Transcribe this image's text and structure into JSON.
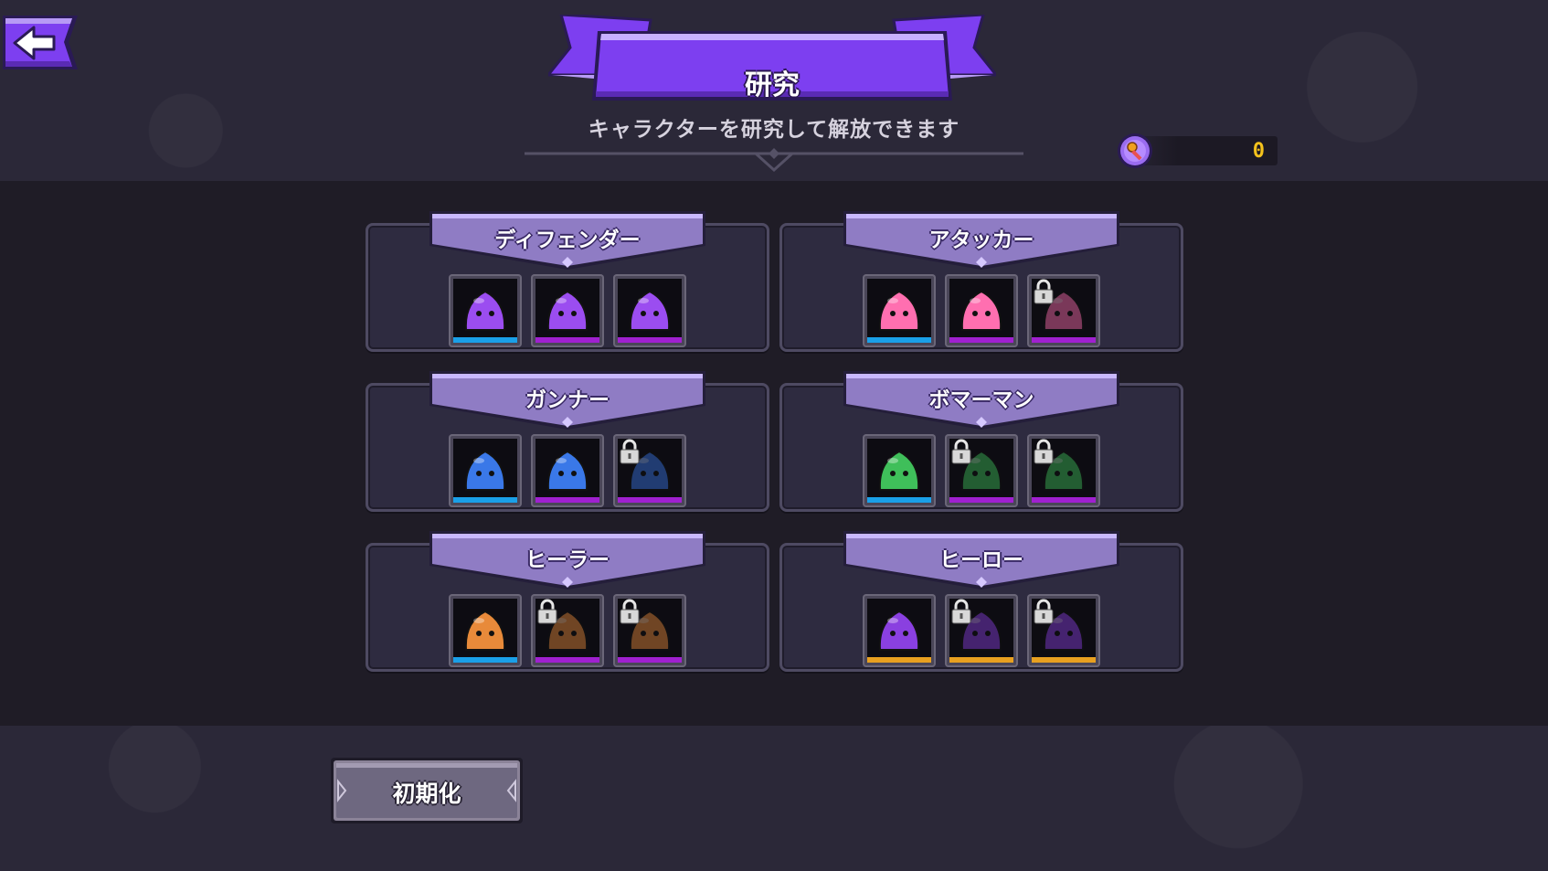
{
  "header": {
    "title": "研究",
    "subtitle": "キャラクターを研究して解放できます",
    "back_icon": "arrow-left-icon"
  },
  "currency": {
    "icon": "research-token-icon",
    "value": "0",
    "color": "#f4c21c"
  },
  "colors": {
    "accent": "#7d3ff0",
    "banner": "#8f7cc4",
    "tier_blue": "#1aa0e8",
    "tier_purple": "#a020d0",
    "tier_gold": "#e8a020"
  },
  "categories": [
    {
      "name": "ディフェンダー",
      "slots": [
        {
          "icon": "purple-slime-defender-icon",
          "tier": "blue",
          "locked": false
        },
        {
          "icon": "purple-slime-knight-icon",
          "tier": "purple",
          "locked": false
        },
        {
          "icon": "purple-slime-shield-icon",
          "tier": "purple",
          "locked": false
        }
      ]
    },
    {
      "name": "アタッカー",
      "slots": [
        {
          "icon": "pink-slime-mace-icon",
          "tier": "blue",
          "locked": false
        },
        {
          "icon": "pink-slime-swordsman-icon",
          "tier": "purple",
          "locked": false
        },
        {
          "icon": "pink-slime-locked-icon",
          "tier": "purple",
          "locked": true
        }
      ]
    },
    {
      "name": "ガンナー",
      "slots": [
        {
          "icon": "blue-slime-gunner-icon",
          "tier": "blue",
          "locked": false
        },
        {
          "icon": "blue-slime-rifleman-icon",
          "tier": "purple",
          "locked": false
        },
        {
          "icon": "blue-slime-sniper-icon",
          "tier": "purple",
          "locked": true
        }
      ]
    },
    {
      "name": "ボマーマン",
      "slots": [
        {
          "icon": "green-slime-bomber-icon",
          "tier": "blue",
          "locked": false
        },
        {
          "icon": "green-slime-grenadier-icon",
          "tier": "purple",
          "locked": true
        },
        {
          "icon": "green-slime-demolisher-icon",
          "tier": "purple",
          "locked": true
        }
      ]
    },
    {
      "name": "ヒーラー",
      "slots": [
        {
          "icon": "orange-slime-nurse-icon",
          "tier": "blue",
          "locked": false
        },
        {
          "icon": "orange-slime-medic-icon",
          "tier": "purple",
          "locked": true
        },
        {
          "icon": "orange-slime-doctor-icon",
          "tier": "purple",
          "locked": true
        }
      ]
    },
    {
      "name": "ヒーロー",
      "slots": [
        {
          "icon": "hero-girl-icon",
          "tier": "gold",
          "locked": false
        },
        {
          "icon": "hero-dark-icon",
          "tier": "gold",
          "locked": true
        },
        {
          "icon": "hero-shadow-icon",
          "tier": "gold",
          "locked": true
        }
      ]
    }
  ],
  "reset_button": {
    "label": "初期化"
  }
}
